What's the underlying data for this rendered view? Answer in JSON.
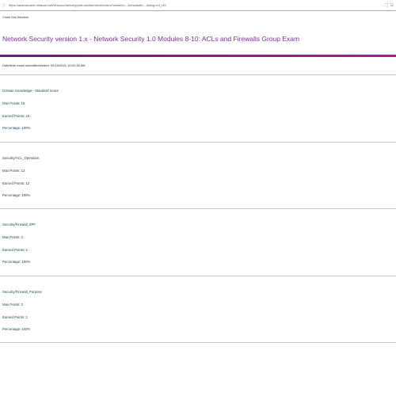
{
  "browser": {
    "url": "https://assessment.netacad.net/virtuoso/delivery/pub-doc/itemreview.html?wsrefId=...&resultsId=...&lang=en_US",
    "icons": [
      "info-icon",
      "translate-icon",
      "reader-icon"
    ]
  },
  "breadcrumb": "Close this Window",
  "title": "Network Security version 1.x - Network Security 1.0 Modules 8-10: ACLs and Firewalls Group Exam",
  "date_line": "Date/time exam submitted/ended: 02/10/2021 10:02:18 AM",
  "sections": [
    {
      "name": "Domain Knowledge - Standard Score",
      "max": "Max Points: 16",
      "earned": "Earned Points: 16",
      "pct": "Percentage: 100%"
    },
    {
      "name": "Security/ACL_Operation",
      "max": "Max Points: 12",
      "earned": "Earned Points: 12",
      "pct": "Percentage: 100%"
    },
    {
      "name": "Security/Firewall_ZPF",
      "max": "Max Points: 2",
      "earned": "Earned Points: 2",
      "pct": "Percentage: 100%"
    },
    {
      "name": "Security/Firewall_Purpose",
      "max": "Max Points: 2",
      "earned": "Earned Points: 2",
      "pct": "Percentage: 100%"
    }
  ]
}
